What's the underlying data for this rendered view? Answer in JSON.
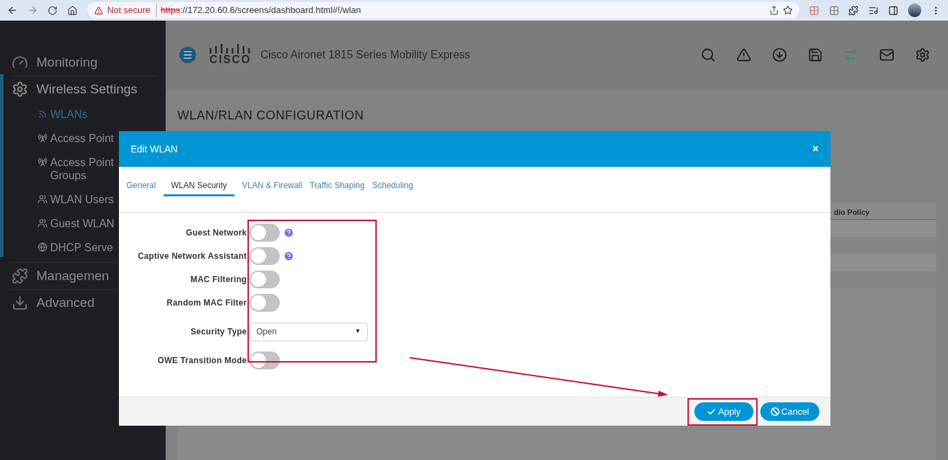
{
  "browser": {
    "security": "Not secure",
    "url_scheme": "https",
    "url_rest": "://172.20.60.6/screens/dashboard.html#!/wlan"
  },
  "sidebar": {
    "items": [
      {
        "label": "Monitoring",
        "selected": false
      },
      {
        "label": "Wireless Settings",
        "selected": true,
        "children": [
          {
            "label": "WLANs",
            "selected": true
          },
          {
            "label": "Access Point",
            "selected": false
          },
          {
            "label": "Access Point",
            "sublabel": "Groups",
            "selected": false
          },
          {
            "label": "WLAN Users",
            "selected": false
          },
          {
            "label": "Guest WLAN",
            "selected": false
          },
          {
            "label": "DHCP Serve",
            "selected": false
          }
        ]
      },
      {
        "label": "Managemen",
        "selected": false
      },
      {
        "label": "Advanced",
        "selected": false
      }
    ]
  },
  "header": {
    "logo_text": "CISCO",
    "title": "Cisco Aironet 1815 Series Mobility Express"
  },
  "page": {
    "title": "WLAN/RLAN CONFIGURATION",
    "table": {
      "columns": [
        "dio Policy"
      ]
    }
  },
  "dialog": {
    "title": "Edit WLAN",
    "close": "×",
    "tabs": [
      {
        "label": "General",
        "selected": false
      },
      {
        "label": "WLAN Security",
        "selected": true
      },
      {
        "label": "VLAN & Firewall",
        "selected": false
      },
      {
        "label": "Traffic Shaping",
        "selected": false
      },
      {
        "label": "Scheduling",
        "selected": false
      }
    ],
    "fields": [
      {
        "kind": "toggle",
        "label": "Guest Network",
        "on": false,
        "help": true
      },
      {
        "kind": "toggle",
        "label": "Captive Network Assistant",
        "on": false,
        "help": true
      },
      {
        "kind": "toggle",
        "label": "MAC Filtering",
        "on": false,
        "help": false
      },
      {
        "kind": "toggle",
        "label": "Random MAC Filter",
        "on": false,
        "help": false
      },
      {
        "kind": "select",
        "label": "Security Type",
        "value": "Open",
        "arrow": "▼"
      },
      {
        "kind": "toggle",
        "label": "OWE Transition Mode",
        "on": false,
        "help": false
      }
    ],
    "buttons": [
      {
        "kind": "apply",
        "label": "Apply"
      },
      {
        "kind": "cancel",
        "label": "Cancel"
      }
    ]
  }
}
